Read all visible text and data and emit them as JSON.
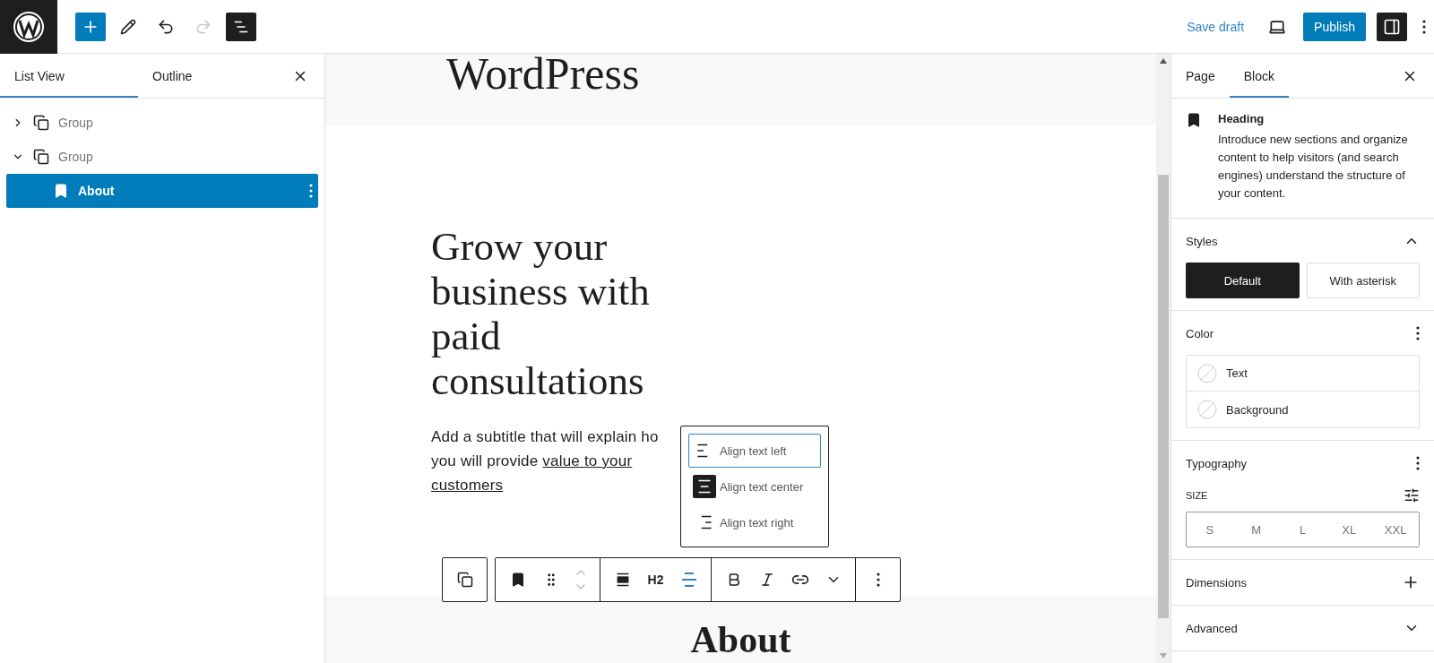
{
  "topbar": {
    "save_label": "Save draft",
    "publish_label": "Publish"
  },
  "list_panel": {
    "tabs": [
      {
        "label": "List View",
        "selected": true
      },
      {
        "label": "Outline",
        "selected": false
      }
    ],
    "tree": [
      {
        "label": "Group",
        "kind": "group",
        "expanded": false,
        "selected": false
      },
      {
        "label": "Group",
        "kind": "group",
        "expanded": true,
        "selected": false,
        "children": [
          {
            "label": "About",
            "kind": "heading",
            "selected": true
          }
        ]
      }
    ]
  },
  "canvas": {
    "site_title": "WordPress",
    "heading": "Grow your business with paid consultations",
    "subtitle_lines": [
      "Add a subtitle that will explain ho",
      "you will provide "
    ],
    "link_lines": [
      "value to your ",
      "customers"
    ],
    "align_menu": [
      {
        "label": "Align text left",
        "kind": "left",
        "focused": true,
        "selected": false
      },
      {
        "label": "Align text center",
        "kind": "center",
        "focused": false,
        "selected": true
      },
      {
        "label": "Align text right",
        "kind": "right",
        "focused": false,
        "selected": false
      }
    ],
    "toolbar": {
      "heading_level": "H2",
      "align_open": true
    },
    "next_heading": "About"
  },
  "settings_panel": {
    "tabs": [
      {
        "label": "Page",
        "selected": false
      },
      {
        "label": "Block",
        "selected": true
      }
    ],
    "block": {
      "title": "Heading",
      "description": "Introduce new sections and organize content to help visitors (and search engines) understand the structure of your content."
    },
    "styles": {
      "title": "Styles",
      "expanded": true,
      "options": [
        {
          "label": "Default",
          "selected": true
        },
        {
          "label": "With asterisk",
          "selected": false
        }
      ]
    },
    "color": {
      "title": "Color",
      "items": [
        "Text",
        "Background"
      ]
    },
    "typography": {
      "title": "Typography",
      "size_label": "SIZE",
      "sizes": [
        {
          "label": "S",
          "selected": false
        },
        {
          "label": "M",
          "selected": false
        },
        {
          "label": "L",
          "selected": false
        },
        {
          "label": "XL",
          "selected": false
        },
        {
          "label": "XXL",
          "selected": false
        }
      ]
    },
    "dimensions": {
      "title": "Dimensions"
    },
    "advanced": {
      "title": "Advanced",
      "expanded": false
    }
  }
}
